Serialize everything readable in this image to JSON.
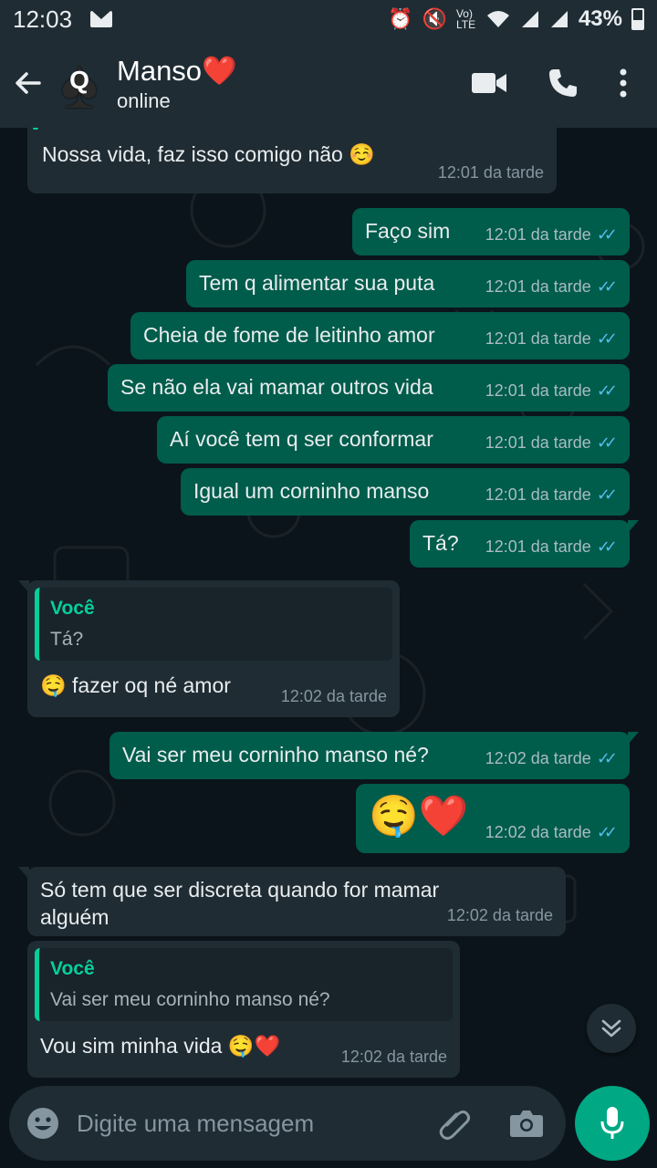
{
  "status_bar": {
    "time": "12:03",
    "battery": "43%",
    "volte": "Vo) LTE"
  },
  "header": {
    "contact_name": "Manso❤️",
    "contact_status": "online",
    "avatar_letter": "Q"
  },
  "messages": [
    {
      "dir": "in",
      "text": "Nossa vida, faz isso comigo não ☺️",
      "time": "12:01 da tarde"
    },
    {
      "dir": "out",
      "text": "Faço sim",
      "time": "12:01 da tarde"
    },
    {
      "dir": "out",
      "text": "Tem q alimentar sua puta",
      "time": "12:01 da tarde"
    },
    {
      "dir": "out",
      "text": "Cheia de fome de leitinho amor",
      "time": "12:01 da tarde"
    },
    {
      "dir": "out",
      "text": "Se não ela vai mamar outros vida",
      "time": "12:01 da tarde"
    },
    {
      "dir": "out",
      "text": "Aí você tem q ser conformar",
      "time": "12:01 da tarde"
    },
    {
      "dir": "out",
      "text": "Igual um corninho  manso",
      "time": "12:01 da tarde"
    },
    {
      "dir": "out",
      "text": "Tá?",
      "time": "12:01 da tarde"
    },
    {
      "dir": "in",
      "quote_author": "Você",
      "quote_text": "Tá?",
      "text": "🤤 fazer oq né amor",
      "time": "12:02 da tarde"
    },
    {
      "dir": "out",
      "text": "Vai ser meu corninho  manso né?",
      "time": "12:02 da tarde"
    },
    {
      "dir": "out",
      "text": "🤤❤️",
      "time": "12:02 da tarde"
    },
    {
      "dir": "in",
      "text_line1": "Só tem que ser discreta quando for mamar",
      "text_line2": "alguém",
      "time": "12:02 da tarde"
    },
    {
      "dir": "in",
      "quote_author": "Você",
      "quote_text": "Vai ser meu corninho  manso né?",
      "text": "Vou sim minha vida 🤤❤️",
      "time": "12:02 da tarde"
    }
  ],
  "input": {
    "placeholder": "Digite uma mensagem"
  },
  "colors": {
    "header_bg": "#1f2c34",
    "chat_bg": "#0b141a",
    "incoming_bubble": "#1f2c34",
    "outgoing_bubble": "#005c4b",
    "accent": "#00a884",
    "read_ticks": "#53bdeb"
  },
  "icons": {
    "back": "arrow-left-icon",
    "video": "video-camera-icon",
    "call": "phone-icon",
    "menu": "more-vertical-icon",
    "emoji": "emoji-icon",
    "attach": "paperclip-icon",
    "camera": "camera-icon",
    "mic": "microphone-icon",
    "scroll": "double-chevron-down-icon"
  }
}
